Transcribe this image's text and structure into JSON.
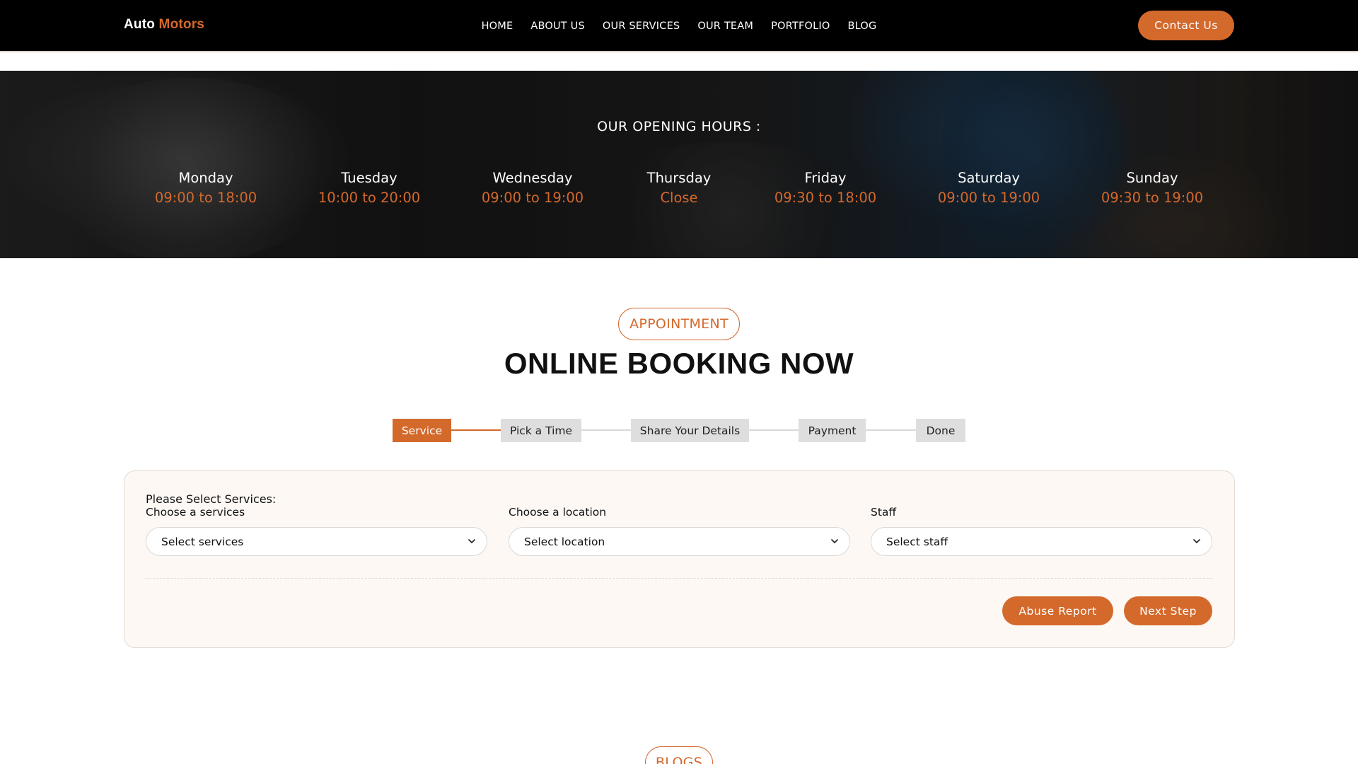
{
  "header": {
    "logo_primary": "Auto",
    "logo_accent": "Motors",
    "nav": [
      "HOME",
      "ABOUT US",
      "OUR SERVICES",
      "OUR TEAM",
      "PORTFOLIO",
      "BLOG"
    ],
    "contact_label": "Contact Us"
  },
  "hours": {
    "title": "OUR OPENING HOURS :",
    "days": [
      {
        "day": "Monday",
        "hours": "09:00 to 18:00"
      },
      {
        "day": "Tuesday",
        "hours": "10:00 to 20:00"
      },
      {
        "day": "Wednesday",
        "hours": "09:00 to 19:00"
      },
      {
        "day": "Thursday",
        "hours": "Close"
      },
      {
        "day": "Friday",
        "hours": "09:30 to 18:00"
      },
      {
        "day": "Saturday",
        "hours": "09:00 to 19:00"
      },
      {
        "day": "Sunday",
        "hours": "09:30 to 19:00"
      }
    ]
  },
  "appointment": {
    "badge": "APPOINTMENT",
    "heading": "ONLINE BOOKING NOW",
    "steps": [
      "Service",
      "Pick a Time",
      "Share Your Details",
      "Payment",
      "Done"
    ],
    "active_step": 0,
    "form": {
      "heading": "Please Select Services:",
      "service_label": "Choose a services",
      "service_value": "Select services",
      "location_label": "Choose a location",
      "location_value": "Select location",
      "staff_label": "Staff",
      "staff_value": "Select staff",
      "abuse_report_label": "Abuse Report",
      "next_step_label": "Next Step"
    }
  },
  "blogs": {
    "badge": "BLOGS"
  },
  "colors": {
    "accent": "#d4692c",
    "navbar_bg": "#000000",
    "step_inactive": "#dedede",
    "card_bg": "#fdf8f4"
  }
}
